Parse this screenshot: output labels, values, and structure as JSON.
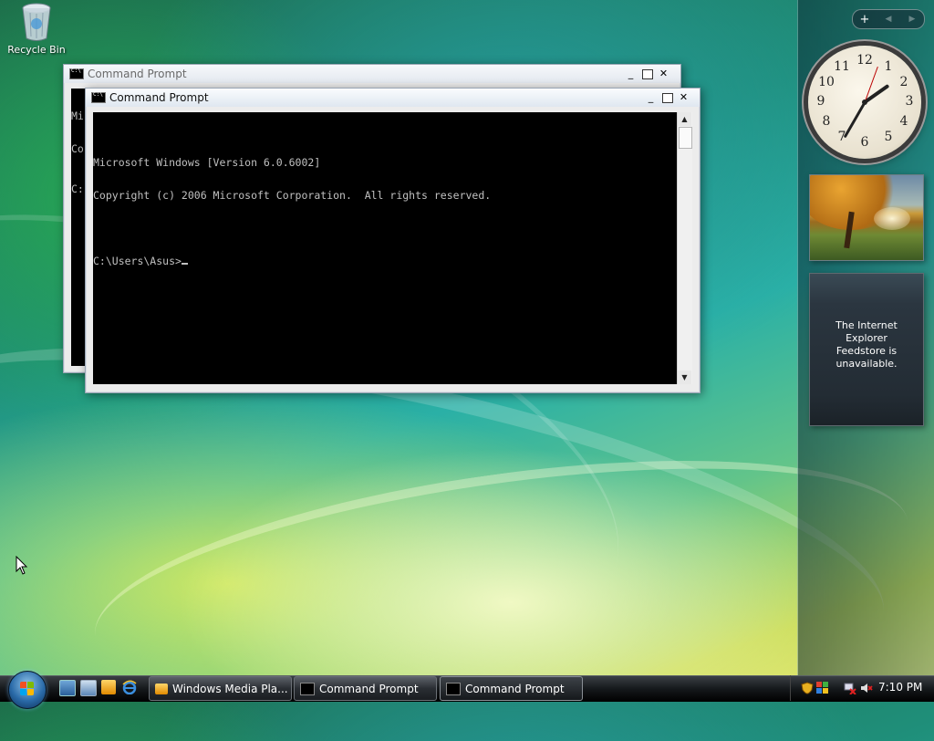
{
  "desktop": {
    "recycle_bin_label": "Recycle Bin"
  },
  "back_window": {
    "title": "Command Prompt",
    "visible_fragments": [
      "Mi",
      "Co",
      "C:"
    ]
  },
  "front_window": {
    "title": "Command Prompt",
    "console_lines": [
      "Microsoft Windows [Version 6.0.6002]",
      "Copyright (c) 2006 Microsoft Corporation.  All rights reserved.",
      "",
      "C:\\Users\\Asus>"
    ]
  },
  "sidebar": {
    "add_gadget": "+",
    "clock_numbers": [
      "12",
      "1",
      "2",
      "3",
      "4",
      "5",
      "6",
      "7",
      "8",
      "9",
      "10",
      "11"
    ],
    "feed_message": "The Internet Explorer\nFeedstore is\nunavailable."
  },
  "taskbar": {
    "buttons": [
      {
        "label": "Windows Media Pla...",
        "icon": "media-player-icon"
      },
      {
        "label": "Command Prompt",
        "icon": "cmd-icon"
      },
      {
        "label": "Command Prompt",
        "icon": "cmd-icon"
      }
    ],
    "time": "7:10 PM"
  },
  "colors": {
    "console_bg": "#000000",
    "console_text": "#c0c0c0",
    "taskbar": "#15181b"
  }
}
